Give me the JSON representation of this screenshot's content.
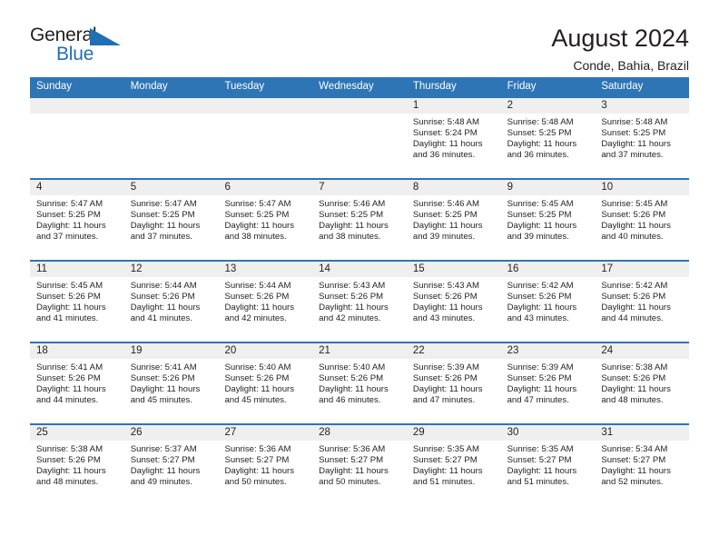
{
  "logo": {
    "word_top": "General",
    "word_bottom": "Blue",
    "triangle_color": "#1f6fb5"
  },
  "header": {
    "title": "August 2024",
    "location": "Conde, Bahia, Brazil"
  },
  "colors": {
    "header_bar": "#2e75b6",
    "day_band": "#efefef",
    "text": "#231f20"
  },
  "weekdays": [
    "Sunday",
    "Monday",
    "Tuesday",
    "Wednesday",
    "Thursday",
    "Friday",
    "Saturday"
  ],
  "weeks": [
    [
      {
        "day": "",
        "empty": true
      },
      {
        "day": "",
        "empty": true
      },
      {
        "day": "",
        "empty": true
      },
      {
        "day": "",
        "empty": true
      },
      {
        "day": "1",
        "sunrise": "Sunrise: 5:48 AM",
        "sunset": "Sunset: 5:24 PM",
        "daylight_1": "Daylight: 11 hours",
        "daylight_2": "and 36 minutes."
      },
      {
        "day": "2",
        "sunrise": "Sunrise: 5:48 AM",
        "sunset": "Sunset: 5:25 PM",
        "daylight_1": "Daylight: 11 hours",
        "daylight_2": "and 36 minutes."
      },
      {
        "day": "3",
        "sunrise": "Sunrise: 5:48 AM",
        "sunset": "Sunset: 5:25 PM",
        "daylight_1": "Daylight: 11 hours",
        "daylight_2": "and 37 minutes."
      }
    ],
    [
      {
        "day": "4",
        "sunrise": "Sunrise: 5:47 AM",
        "sunset": "Sunset: 5:25 PM",
        "daylight_1": "Daylight: 11 hours",
        "daylight_2": "and 37 minutes."
      },
      {
        "day": "5",
        "sunrise": "Sunrise: 5:47 AM",
        "sunset": "Sunset: 5:25 PM",
        "daylight_1": "Daylight: 11 hours",
        "daylight_2": "and 37 minutes."
      },
      {
        "day": "6",
        "sunrise": "Sunrise: 5:47 AM",
        "sunset": "Sunset: 5:25 PM",
        "daylight_1": "Daylight: 11 hours",
        "daylight_2": "and 38 minutes."
      },
      {
        "day": "7",
        "sunrise": "Sunrise: 5:46 AM",
        "sunset": "Sunset: 5:25 PM",
        "daylight_1": "Daylight: 11 hours",
        "daylight_2": "and 38 minutes."
      },
      {
        "day": "8",
        "sunrise": "Sunrise: 5:46 AM",
        "sunset": "Sunset: 5:25 PM",
        "daylight_1": "Daylight: 11 hours",
        "daylight_2": "and 39 minutes."
      },
      {
        "day": "9",
        "sunrise": "Sunrise: 5:45 AM",
        "sunset": "Sunset: 5:25 PM",
        "daylight_1": "Daylight: 11 hours",
        "daylight_2": "and 39 minutes."
      },
      {
        "day": "10",
        "sunrise": "Sunrise: 5:45 AM",
        "sunset": "Sunset: 5:26 PM",
        "daylight_1": "Daylight: 11 hours",
        "daylight_2": "and 40 minutes."
      }
    ],
    [
      {
        "day": "11",
        "sunrise": "Sunrise: 5:45 AM",
        "sunset": "Sunset: 5:26 PM",
        "daylight_1": "Daylight: 11 hours",
        "daylight_2": "and 41 minutes."
      },
      {
        "day": "12",
        "sunrise": "Sunrise: 5:44 AM",
        "sunset": "Sunset: 5:26 PM",
        "daylight_1": "Daylight: 11 hours",
        "daylight_2": "and 41 minutes."
      },
      {
        "day": "13",
        "sunrise": "Sunrise: 5:44 AM",
        "sunset": "Sunset: 5:26 PM",
        "daylight_1": "Daylight: 11 hours",
        "daylight_2": "and 42 minutes."
      },
      {
        "day": "14",
        "sunrise": "Sunrise: 5:43 AM",
        "sunset": "Sunset: 5:26 PM",
        "daylight_1": "Daylight: 11 hours",
        "daylight_2": "and 42 minutes."
      },
      {
        "day": "15",
        "sunrise": "Sunrise: 5:43 AM",
        "sunset": "Sunset: 5:26 PM",
        "daylight_1": "Daylight: 11 hours",
        "daylight_2": "and 43 minutes."
      },
      {
        "day": "16",
        "sunrise": "Sunrise: 5:42 AM",
        "sunset": "Sunset: 5:26 PM",
        "daylight_1": "Daylight: 11 hours",
        "daylight_2": "and 43 minutes."
      },
      {
        "day": "17",
        "sunrise": "Sunrise: 5:42 AM",
        "sunset": "Sunset: 5:26 PM",
        "daylight_1": "Daylight: 11 hours",
        "daylight_2": "and 44 minutes."
      }
    ],
    [
      {
        "day": "18",
        "sunrise": "Sunrise: 5:41 AM",
        "sunset": "Sunset: 5:26 PM",
        "daylight_1": "Daylight: 11 hours",
        "daylight_2": "and 44 minutes."
      },
      {
        "day": "19",
        "sunrise": "Sunrise: 5:41 AM",
        "sunset": "Sunset: 5:26 PM",
        "daylight_1": "Daylight: 11 hours",
        "daylight_2": "and 45 minutes."
      },
      {
        "day": "20",
        "sunrise": "Sunrise: 5:40 AM",
        "sunset": "Sunset: 5:26 PM",
        "daylight_1": "Daylight: 11 hours",
        "daylight_2": "and 45 minutes."
      },
      {
        "day": "21",
        "sunrise": "Sunrise: 5:40 AM",
        "sunset": "Sunset: 5:26 PM",
        "daylight_1": "Daylight: 11 hours",
        "daylight_2": "and 46 minutes."
      },
      {
        "day": "22",
        "sunrise": "Sunrise: 5:39 AM",
        "sunset": "Sunset: 5:26 PM",
        "daylight_1": "Daylight: 11 hours",
        "daylight_2": "and 47 minutes."
      },
      {
        "day": "23",
        "sunrise": "Sunrise: 5:39 AM",
        "sunset": "Sunset: 5:26 PM",
        "daylight_1": "Daylight: 11 hours",
        "daylight_2": "and 47 minutes."
      },
      {
        "day": "24",
        "sunrise": "Sunrise: 5:38 AM",
        "sunset": "Sunset: 5:26 PM",
        "daylight_1": "Daylight: 11 hours",
        "daylight_2": "and 48 minutes."
      }
    ],
    [
      {
        "day": "25",
        "sunrise": "Sunrise: 5:38 AM",
        "sunset": "Sunset: 5:26 PM",
        "daylight_1": "Daylight: 11 hours",
        "daylight_2": "and 48 minutes."
      },
      {
        "day": "26",
        "sunrise": "Sunrise: 5:37 AM",
        "sunset": "Sunset: 5:27 PM",
        "daylight_1": "Daylight: 11 hours",
        "daylight_2": "and 49 minutes."
      },
      {
        "day": "27",
        "sunrise": "Sunrise: 5:36 AM",
        "sunset": "Sunset: 5:27 PM",
        "daylight_1": "Daylight: 11 hours",
        "daylight_2": "and 50 minutes."
      },
      {
        "day": "28",
        "sunrise": "Sunrise: 5:36 AM",
        "sunset": "Sunset: 5:27 PM",
        "daylight_1": "Daylight: 11 hours",
        "daylight_2": "and 50 minutes."
      },
      {
        "day": "29",
        "sunrise": "Sunrise: 5:35 AM",
        "sunset": "Sunset: 5:27 PM",
        "daylight_1": "Daylight: 11 hours",
        "daylight_2": "and 51 minutes."
      },
      {
        "day": "30",
        "sunrise": "Sunrise: 5:35 AM",
        "sunset": "Sunset: 5:27 PM",
        "daylight_1": "Daylight: 11 hours",
        "daylight_2": "and 51 minutes."
      },
      {
        "day": "31",
        "sunrise": "Sunrise: 5:34 AM",
        "sunset": "Sunset: 5:27 PM",
        "daylight_1": "Daylight: 11 hours",
        "daylight_2": "and 52 minutes."
      }
    ]
  ]
}
